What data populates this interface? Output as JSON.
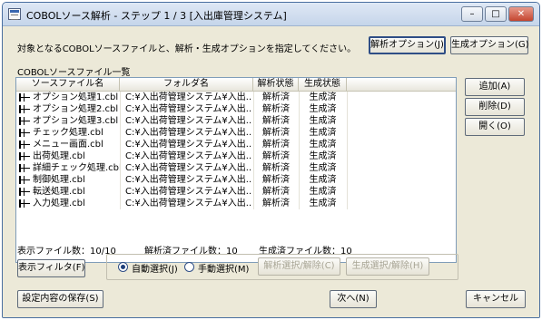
{
  "window": {
    "title": "COBOLソース解析 - ステップ 1 / 3 [入出庫管理システム]",
    "min_icon": "minimize-icon",
    "max_icon": "maximize-icon",
    "close_icon": "close-icon",
    "min_glyph": "–",
    "max_glyph": "□",
    "close_glyph": "✕"
  },
  "instruction": "対象となるCOBOLソースファイルと、解析・生成オプションを指定してください。",
  "buttons": {
    "analysis_options": "解析オプション(J)",
    "generate_options": "生成オプション(G)",
    "add": "追加(A)",
    "delete": "削除(D)",
    "open": "開く(O)",
    "display_filter": "表示フィルタ(F)",
    "analysis_select": "解析選択/解除(C)",
    "generate_select": "生成選択/解除(H)",
    "save_settings": "設定内容の保存(S)",
    "next": "次へ(N)",
    "cancel": "キャンセル"
  },
  "file_list": {
    "title": "COBOLソースファイル一覧",
    "columns": [
      "ソースファイル名",
      "フォルダ名",
      "解析状態",
      "生成状態"
    ],
    "rows": [
      {
        "file": "オプション処理1.cbl",
        "folder": "C:¥入出荷管理システム¥入出...",
        "analysis": "解析済",
        "generate": "生成済"
      },
      {
        "file": "オプション処理2.cbl",
        "folder": "C:¥入出荷管理システム¥入出...",
        "analysis": "解析済",
        "generate": "生成済"
      },
      {
        "file": "オプション処理3.cbl",
        "folder": "C:¥入出荷管理システム¥入出...",
        "analysis": "解析済",
        "generate": "生成済"
      },
      {
        "file": "チェック処理.cbl",
        "folder": "C:¥入出荷管理システム¥入出...",
        "analysis": "解析済",
        "generate": "生成済"
      },
      {
        "file": "メニュー画面.cbl",
        "folder": "C:¥入出荷管理システム¥入出...",
        "analysis": "解析済",
        "generate": "生成済"
      },
      {
        "file": "出荷処理.cbl",
        "folder": "C:¥入出荷管理システム¥入出...",
        "analysis": "解析済",
        "generate": "生成済"
      },
      {
        "file": "詳細チェック処理.cbl",
        "folder": "C:¥入出荷管理システム¥入出...",
        "analysis": "解析済",
        "generate": "生成済"
      },
      {
        "file": "制御処理.cbl",
        "folder": "C:¥入出荷管理システム¥入出...",
        "analysis": "解析済",
        "generate": "生成済"
      },
      {
        "file": "転送処理.cbl",
        "folder": "C:¥入出荷管理システム¥入出...",
        "analysis": "解析済",
        "generate": "生成済"
      },
      {
        "file": "入力処理.cbl",
        "folder": "C:¥入出荷管理システム¥入出...",
        "analysis": "解析済",
        "generate": "生成済"
      }
    ]
  },
  "counts": {
    "displayed": "表示ファイル数：10/10",
    "analyzed": "解析済ファイル数：10",
    "generated": "生成済ファイル数：10"
  },
  "selection": {
    "auto": "自動選択(J)",
    "manual": "手動選択(M)",
    "selected": "auto"
  }
}
